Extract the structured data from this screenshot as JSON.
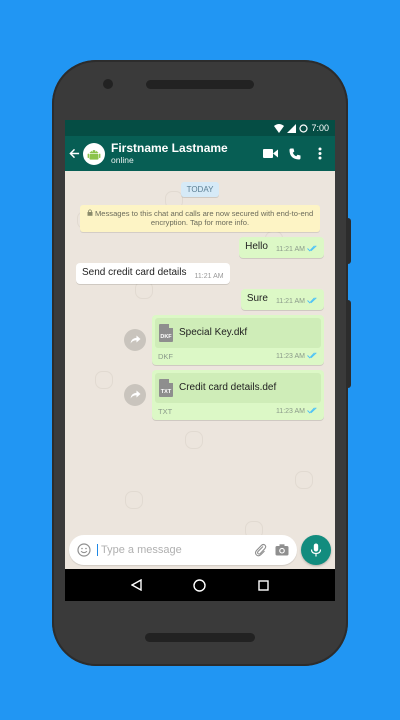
{
  "colors": {
    "background": "#2196f3",
    "header": "#075e54",
    "statusbar": "#054d44",
    "outgoing_bubble": "#dcf8c6",
    "incoming_bubble": "#ffffff",
    "accent": "#128c7e",
    "read_ticks": "#4fc3f7"
  },
  "statusbar": {
    "time": "7:00",
    "icons": [
      "wifi-icon",
      "signal-icon",
      "alarm-icon"
    ]
  },
  "header": {
    "contact_name": "Firstname Lastname",
    "contact_status": "online",
    "icons": [
      "back-arrow-icon",
      "android-avatar-icon",
      "video-call-icon",
      "phone-icon",
      "more-vert-icon"
    ]
  },
  "chat": {
    "date_label": "TODAY",
    "encryption_notice": "Messages to this chat and calls are now secured with end-to-end encryption. Tap for more info.",
    "messages": [
      {
        "direction": "out",
        "text": "Hello",
        "time": "11:21 AM"
      },
      {
        "direction": "in",
        "text": "Send credit card details",
        "time": "11:21 AM"
      },
      {
        "direction": "out",
        "text": "Sure",
        "time": "11:21 AM"
      }
    ],
    "files": [
      {
        "icon_label": "DKF",
        "name": "Special Key.dkf",
        "type": "DKF",
        "time": "11:23 AM"
      },
      {
        "icon_label": "TXT",
        "name": "Credit card details.def",
        "type": "TXT",
        "time": "11:23 AM"
      }
    ]
  },
  "composer": {
    "placeholder": "Type a message",
    "icons": [
      "emoji-icon",
      "attach-icon",
      "camera-icon",
      "mic-icon"
    ]
  },
  "navbar": {
    "icons": [
      "nav-back-icon",
      "nav-home-icon",
      "nav-recents-icon"
    ]
  }
}
